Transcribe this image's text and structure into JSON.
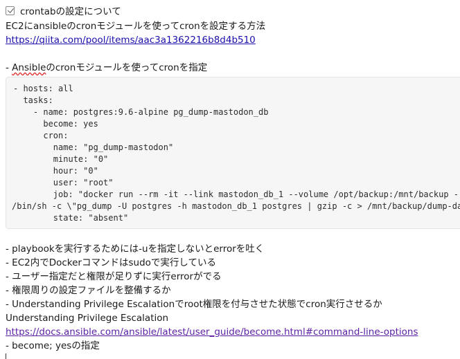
{
  "todo": {
    "checked": true,
    "title": "crontabの設定について"
  },
  "note": {
    "heading": "EC2にansibleのcronモジュールを使ってcronを設定する方法",
    "ref_link": "https://qiita.com/pool/items/aac3a1362216b8d4b510",
    "section_prefix": "- ",
    "section_word": "Ansible",
    "section_rest": "のcronモジュールを使ってcronを指定",
    "code_lines": [
      "- hosts: all",
      "  tasks:",
      "    - name: postgres:9.6-alpine pg_dump-mastodon_db",
      "      become: yes",
      "      cron:",
      "        name: \"pg_dump-mastodon\"",
      "        minute: \"0\"",
      "        hour: \"0\"",
      "        user: \"root\"",
      "        job: \"docker run --rm -it --link mastodon_db_1 --volume /opt/backup:/mnt/backup --",
      "/bin/sh -c \\\"pg_dump -U postgres -h mastodon_db_1 postgres | gzip -c > /mnt/backup/dump-da",
      "        state: \"absent\""
    ],
    "bullets": [
      "- playbookを実行するためには-uを指定しないとerrorを吐く",
      "- EC2内でDockerコマンドはsudoで実行している",
      "- ユーザー指定だと権限が足りずに実行errorがでる",
      "- 権限周りの設定ファイルを整備するか",
      "- Understanding Privilege Escalationでroot権限を付与させた状態でcron実行させるか"
    ],
    "doc_title": "Understanding Privilege Escalation",
    "doc_link": "https://docs.ansible.com/ansible/latest/user_guide/become.html#command-line-options",
    "last_line": "- become; yesの指定"
  },
  "colors": {
    "link": "#1a0dab",
    "visited_link": "#5b1fa6",
    "code_background": "#f6f6f6",
    "spellcheck": "#e03030"
  },
  "icons": {
    "checkbox": "checkmark-icon"
  }
}
